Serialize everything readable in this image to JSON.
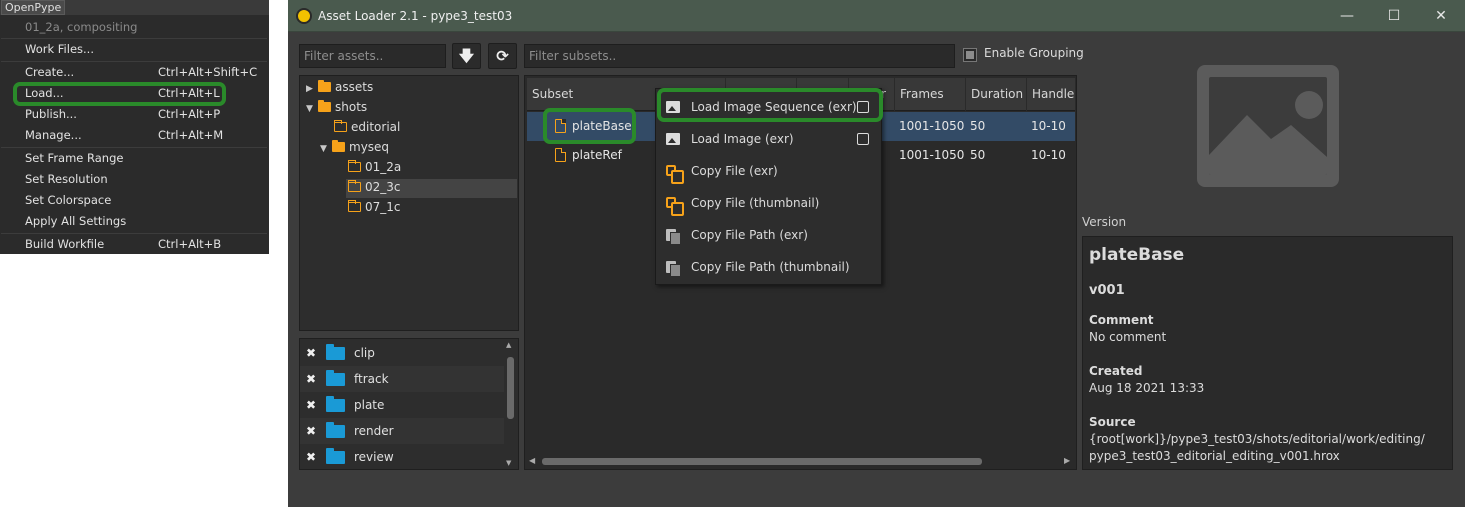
{
  "openpype_menu": {
    "title": "OpenPype",
    "context": "01_2a, compositing",
    "items": [
      {
        "label": "Work Files...",
        "shortcut": ""
      },
      {
        "label": "Create...",
        "shortcut": "Ctrl+Alt+Shift+C"
      },
      {
        "label": "Load...",
        "shortcut": "Ctrl+Alt+L"
      },
      {
        "label": "Publish...",
        "shortcut": "Ctrl+Alt+P"
      },
      {
        "label": "Manage...",
        "shortcut": "Ctrl+Alt+M"
      },
      {
        "label": "Set Frame Range",
        "shortcut": ""
      },
      {
        "label": "Set Resolution",
        "shortcut": ""
      },
      {
        "label": "Set Colorspace",
        "shortcut": ""
      },
      {
        "label": "Apply All Settings",
        "shortcut": ""
      },
      {
        "label": "Build Workfile",
        "shortcut": "Ctrl+Alt+B"
      }
    ]
  },
  "window": {
    "title": "Asset Loader 2.1 - pype3_test03",
    "minimize_glyph": "—",
    "maximize_glyph": "☐",
    "close_glyph": "✕"
  },
  "assets": {
    "filter_placeholder": "Filter assets..",
    "down_button_glyph": "🡇",
    "refresh_button_glyph": "⟳",
    "tree": [
      {
        "label": "assets",
        "arrow": "▶",
        "folder": "filled"
      },
      {
        "label": "shots",
        "arrow": "▼",
        "folder": "filled"
      },
      {
        "label": "editorial",
        "arrow": "",
        "folder": "outline"
      },
      {
        "label": "myseq",
        "arrow": "▼",
        "folder": "filled"
      },
      {
        "label": "01_2a",
        "arrow": "",
        "folder": "outline"
      },
      {
        "label": "02_3c",
        "arrow": "",
        "folder": "outline",
        "selected": true
      },
      {
        "label": "07_1c",
        "arrow": "",
        "folder": "outline"
      }
    ]
  },
  "families": {
    "remove_glyph": "✖",
    "items": [
      "clip",
      "ftrack",
      "plate",
      "render",
      "review"
    ]
  },
  "subsets": {
    "filter_placeholder": "Filter subsets..",
    "enable_grouping_label": "Enable Grouping",
    "enable_grouping_checked": true,
    "columns": [
      "Subset",
      "",
      "",
      "",
      "Frames",
      "Duration",
      "Handle"
    ],
    "column_extra_text": "r",
    "rows": [
      {
        "subset": "plateBase",
        "frames": "1001-1050",
        "duration": "50",
        "handle": "10-10",
        "selected": true
      },
      {
        "subset": "plateRef",
        "frames": "1001-1050",
        "duration": "50",
        "handle": "10-10",
        "selected": false
      }
    ]
  },
  "context_menu": {
    "items": [
      {
        "label": "Load Image Sequence (exr)",
        "icon": "image-sequence-icon",
        "options": true
      },
      {
        "label": "Load Image (exr)",
        "icon": "image-icon",
        "options": true
      },
      {
        "label": "Copy File (exr)",
        "icon": "copy-icon",
        "options": false
      },
      {
        "label": "Copy File (thumbnail)",
        "icon": "copy-icon",
        "options": false
      },
      {
        "label": "Copy File Path (exr)",
        "icon": "copy-path-icon",
        "options": false
      },
      {
        "label": "Copy File Path (thumbnail)",
        "icon": "copy-path-icon",
        "options": false
      }
    ]
  },
  "version": {
    "section_label": "Version",
    "subset_name": "plateBase",
    "version": "v001",
    "comment_label": "Comment",
    "comment": "No comment",
    "created_label": "Created",
    "created": "Aug 18 2021 13:33",
    "source_label": "Source",
    "source_line1": "{root[work]}/pype3_test03/shots/editorial/work/editing/",
    "source_line2": "pype3_test03_editorial_editing_v001.hrox"
  },
  "colors": {
    "highlight": "#2a8a2a",
    "folder": "#f6a21a",
    "family_folder": "#1a9ad6",
    "selection": "#334b66"
  }
}
